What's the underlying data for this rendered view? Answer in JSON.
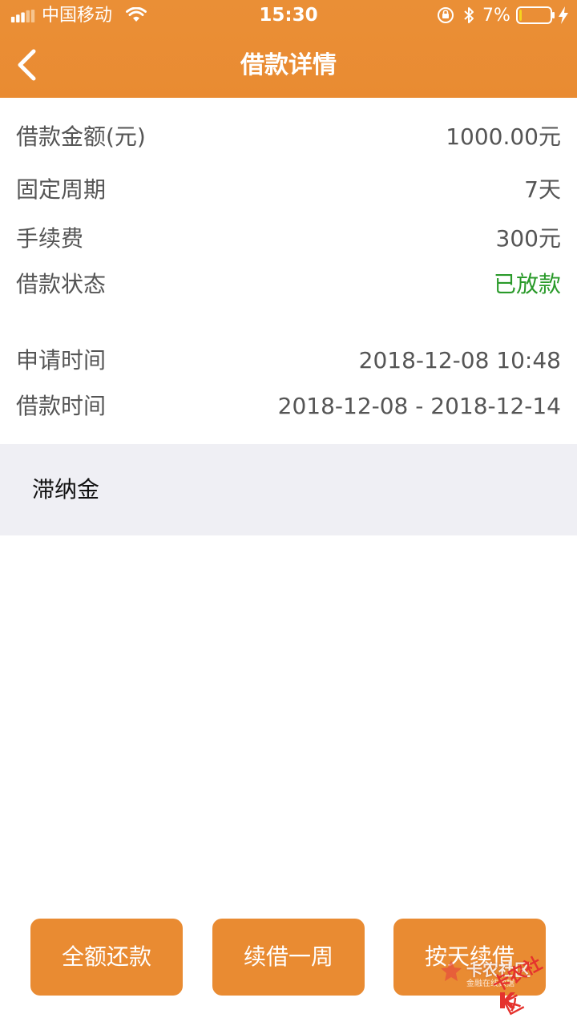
{
  "status_bar": {
    "carrier": "中国移动",
    "time": "15:30",
    "battery_percent_text": "7%",
    "battery_level": 0.07,
    "signal_icon": "signal-icon",
    "wifi_icon": "wifi-icon",
    "lock_icon": "orientation-lock-icon",
    "bluetooth_icon": "bluetooth-icon",
    "charging_icon": "charging-bolt-icon"
  },
  "nav": {
    "title": "借款详情",
    "back_icon": "chevron-left-icon"
  },
  "details": [
    {
      "label": "借款金额(元)",
      "value": "1000.00元"
    },
    {
      "label": "固定周期",
      "value": "7天"
    },
    {
      "label": "手续费",
      "value": "300元"
    },
    {
      "label": "借款状态",
      "value": "已放款"
    },
    {
      "label": "申请时间",
      "value": "2018-12-08 10:48"
    },
    {
      "label": "借款时间",
      "value": "2018-12-08 - 2018-12-14"
    }
  ],
  "late_fee": {
    "label": "滞纳金"
  },
  "actions": {
    "full_repay": "全额还款",
    "renew_week": "续借一周",
    "renew_daily": "按天续借"
  },
  "watermark": {
    "text1": "卡农社区",
    "sub": "金融在线数据",
    "text2": "卡农社区"
  },
  "colors": {
    "header_orange": "#e98b32",
    "status_green": "#2a9a2a",
    "section_gray": "#efeff4",
    "text_gray": "#555555"
  }
}
